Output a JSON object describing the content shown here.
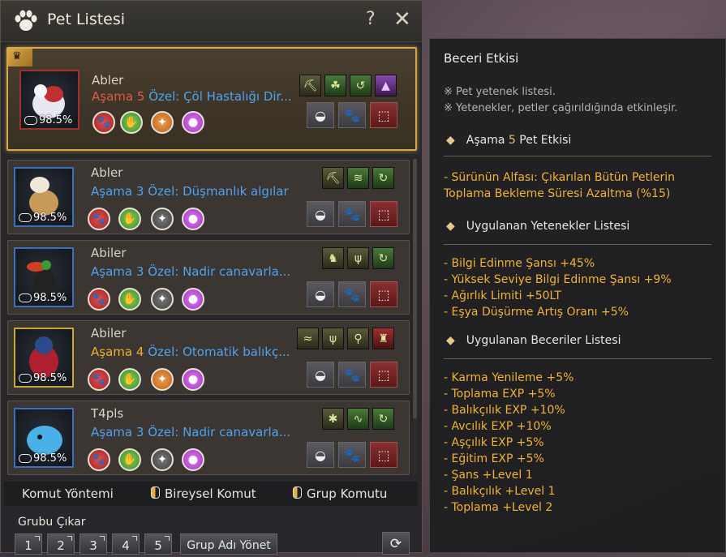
{
  "window": {
    "title": "Pet Listesi",
    "help": "?",
    "close": "✕"
  },
  "pets": [
    {
      "name": "Abler",
      "stage_label": "Aşama",
      "stage": "5",
      "special": "Özel: Çöl Hastalığı Dir...",
      "percent": "98.5%"
    },
    {
      "name": "Abler",
      "stage_label": "Aşama",
      "stage": "3",
      "special": "Özel: Düşmanlık algılar",
      "percent": "98.5%"
    },
    {
      "name": "Abiler",
      "stage_label": "Aşama",
      "stage": "3",
      "special": "Özel: Nadir canavarla...",
      "percent": "98.5%"
    },
    {
      "name": "Abiler",
      "stage_label": "Aşama",
      "stage": "4",
      "special": "Özel: Otomatik balıkç...",
      "percent": "98.5%"
    },
    {
      "name": "T4pls",
      "stage_label": "Aşama",
      "stage": "3",
      "special": "Özel: Nadir canavarla...",
      "percent": "98.5%"
    }
  ],
  "commands": {
    "method": "Komut Yöntemi",
    "individual": "Bireysel Komut",
    "group": "Grup Komutu"
  },
  "group": {
    "remove": "Grubu Çıkar",
    "numbers": [
      "1",
      "2",
      "3",
      "4",
      "5"
    ],
    "manage": "Grup Adı Yönet",
    "refresh": "⟳"
  },
  "panel": {
    "title": "Beceri Etkisi",
    "notes": [
      "※ Pet yetenek listesi.",
      "※ Yetenekler, petler çağırıldığında etkinleşir."
    ],
    "stage_effect": {
      "prefix": "Aşama",
      "num": "5",
      "suffix": "Pet Etkisi"
    },
    "stage_lines": [
      "- Sürünün Alfası: Çıkarılan Bütün Petlerin",
      "Toplama Bekleme Süresi Azaltma (%15)"
    ],
    "applied_talents_title": "Uygulanan Yetenekler Listesi",
    "talents": [
      "- Bilgi Edinme Şansı +45%",
      "- Yüksek Seviye Bilgi Edinme Şansı +9%",
      "- Ağırlık Limiti +50LT",
      "- Eşya Düşürme Artış Oranı +5%"
    ],
    "applied_skills_title": "Uygulanan Beceriler Listesi",
    "skills": [
      "- Karma Yenileme +5%",
      "- Toplama EXP +5%",
      "- Balıkçılık EXP +10%",
      "- Avcılık EXP +10%",
      "- Aşçılık EXP +5%",
      "- Eğitim EXP +5%",
      "- Şans +Level 1",
      "- Balıkçılık +Level 1",
      "- Toplama +Level 2"
    ]
  },
  "colors": {
    "accent_gold": "#d6a84a",
    "stage_blue": "#4ea3f0",
    "stage_gold": "#f0b030",
    "stage_red": "#e05a4a",
    "effect_text": "#f2b238"
  }
}
